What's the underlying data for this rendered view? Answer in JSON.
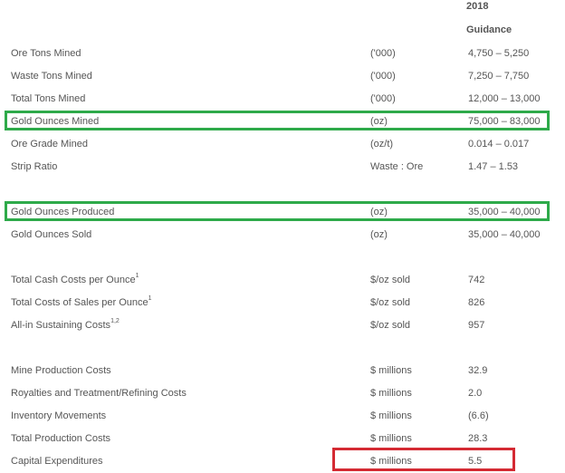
{
  "header": {
    "year": "2018",
    "guidance": "Guidance"
  },
  "rows": [
    {
      "label": "Ore Tons Mined",
      "unit": "('000)",
      "value": "4,750 – 5,250"
    },
    {
      "label": "Waste Tons Mined",
      "unit": "('000)",
      "value": "7,250 – 7,750"
    },
    {
      "label": "Total Tons Mined",
      "unit": "('000)",
      "value": "12,000 – 13,000"
    },
    {
      "label": "Gold Ounces Mined",
      "unit": "(oz)",
      "value": "75,000 – 83,000"
    },
    {
      "label": "Ore Grade Mined",
      "unit": "(oz/t)",
      "value": "0.014 – 0.017"
    },
    {
      "label": "Strip Ratio",
      "unit": "Waste : Ore",
      "value": "1.47 – 1.53"
    },
    {
      "label": "Gold Ounces Produced",
      "unit": "(oz)",
      "value": "35,000 – 40,000"
    },
    {
      "label": "Gold Ounces Sold",
      "unit": "(oz)",
      "value": "35,000 – 40,000"
    },
    {
      "label": "Total Cash Costs per Ounce",
      "sup": "1",
      "unit": "$/oz sold",
      "value": "742"
    },
    {
      "label": "Total Costs of Sales per Ounce",
      "sup": "1",
      "unit": "$/oz sold",
      "value": "826"
    },
    {
      "label": "All-in Sustaining Costs",
      "sup": "1,2",
      "unit": "$/oz sold",
      "value": "957"
    },
    {
      "label": "Mine Production Costs",
      "unit": "$ millions",
      "value": "32.9"
    },
    {
      "label": "Royalties and Treatment/Refining Costs",
      "unit": "$ millions",
      "value": "2.0"
    },
    {
      "label": "Inventory Movements",
      "unit": "$ millions",
      "value": "(6.6)"
    },
    {
      "label": "Total Production Costs",
      "unit": "$ millions",
      "value": "28.3"
    },
    {
      "label": "Capital Expenditures",
      "unit": "$ millions",
      "value": "5.5"
    }
  ],
  "highlights": {
    "green": "#2eaa4a",
    "red": "#d42a33"
  }
}
